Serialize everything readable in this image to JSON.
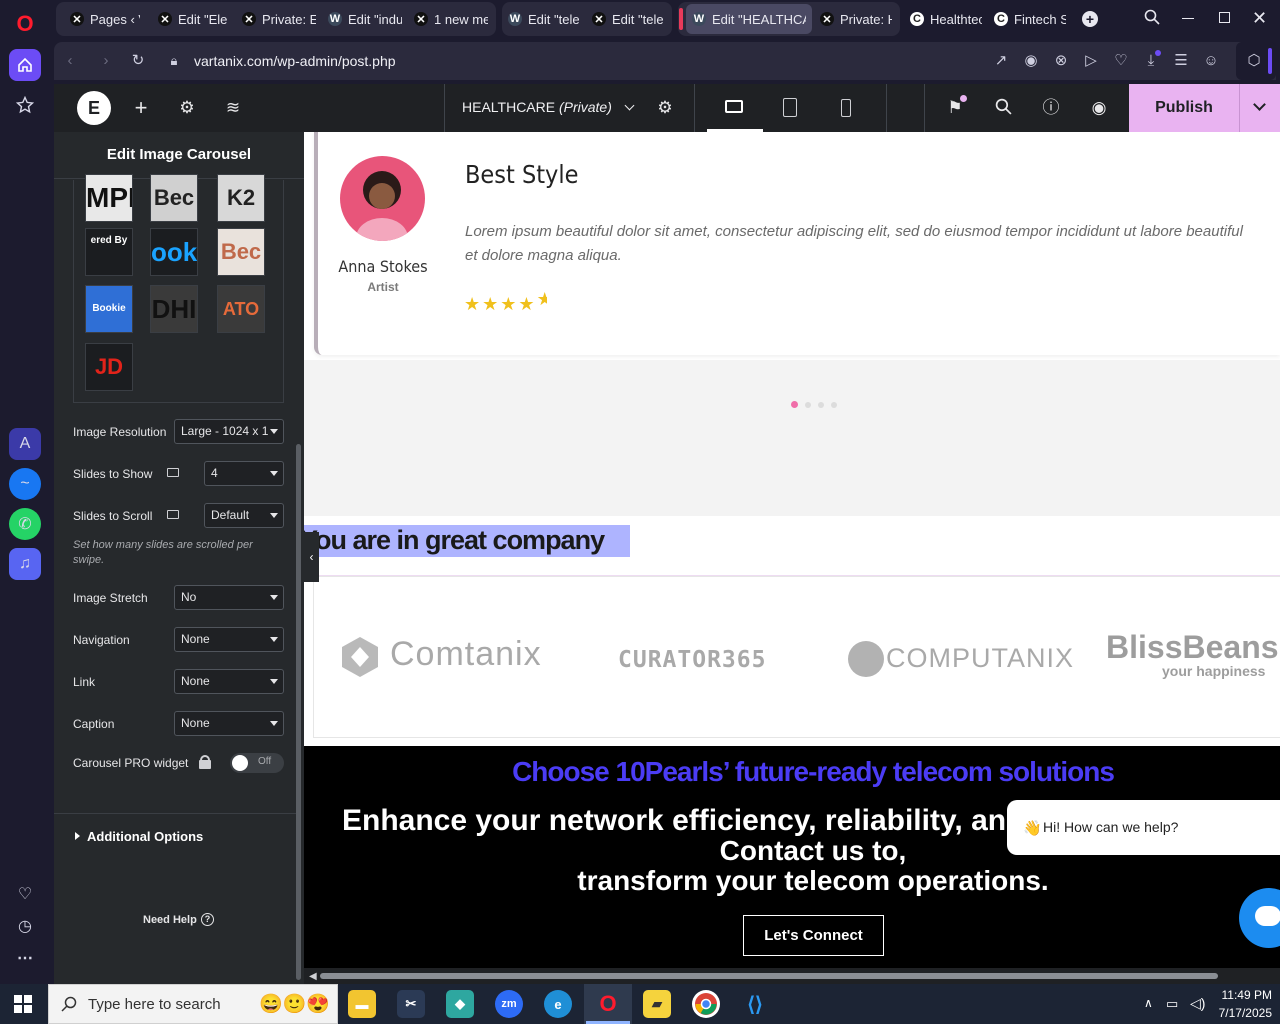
{
  "browser": {
    "tabs": [
      {
        "label": "Pages ‹ Va",
        "icon": "x-icon"
      },
      {
        "label": "Edit \"Elem",
        "icon": "x-icon"
      },
      {
        "label": "Private: Ele",
        "icon": "x-icon"
      },
      {
        "label": "Edit \"indus",
        "icon": "wordpress-icon"
      },
      {
        "label": "1 new mes",
        "icon": "x-icon"
      },
      {
        "label": "Edit \"teleco",
        "icon": "wordpress-icon"
      },
      {
        "label": "Edit \"teleco",
        "icon": "x-icon"
      },
      {
        "label": "Edit \"HEALTHCARE",
        "icon": "wordpress-icon"
      },
      {
        "label": "Private: HE",
        "icon": "x-icon"
      },
      {
        "label": "Healthtech",
        "icon": "clinic-icon"
      },
      {
        "label": "Fintech So",
        "icon": "clinic-icon"
      }
    ],
    "url": "vartanix.com/wp-admin/post.php"
  },
  "editor": {
    "document_title": "HEALTHCARE",
    "document_status": "(Private)",
    "publish_label": "Publish"
  },
  "panel": {
    "title": "Edit Image Carousel",
    "thumbs": [
      "MPL",
      "Bec",
      "K2",
      "ered By",
      "ook",
      "Bec",
      "Bookie",
      "DHI",
      "ATO",
      "JD"
    ],
    "controls": {
      "image_resolution": {
        "label": "Image Resolution",
        "value": "Large - 1024 x 1"
      },
      "slides_to_show": {
        "label": "Slides to Show",
        "value": "4"
      },
      "slides_to_scroll": {
        "label": "Slides to Scroll",
        "value": "Default"
      },
      "scroll_help": "Set how many slides are scrolled per swipe.",
      "image_stretch": {
        "label": "Image Stretch",
        "value": "No"
      },
      "navigation": {
        "label": "Navigation",
        "value": "None"
      },
      "link": {
        "label": "Link",
        "value": "None"
      },
      "caption": {
        "label": "Caption",
        "value": "None"
      },
      "carousel_pro": {
        "label": "Carousel PRO widget",
        "toggle": "Off"
      }
    },
    "additional_options": "Additional Options",
    "need_help": "Need Help"
  },
  "canvas": {
    "testimonial": {
      "name": "Anna Stokes",
      "role": "Artist",
      "heading": "Best Style",
      "body": "Lorem ipsum beautiful dolor sit amet, consectetur adipiscing elit, sed do eiusmod tempor incididunt ut labore beautiful et dolore magna aliqua.",
      "rating": 4.5
    },
    "company_heading": "You are in great company",
    "logos": [
      {
        "name": "Comtanix"
      },
      {
        "name": "CURATOR365"
      },
      {
        "name": "COMPUTANIX"
      },
      {
        "name": "BlissBeans",
        "tagline": "your happiness"
      }
    ],
    "cta": {
      "kicker": "Choose 10Pearls’ future-ready telecom solutions",
      "line1": "Enhance your network efficiency, reliability, and cu",
      "line2": "Contact us to,",
      "line3": "transform your telecom operations.",
      "button": "Let's Connect"
    },
    "chat": {
      "message": "Hi! How can we help?"
    }
  },
  "taskbar": {
    "search_placeholder": "Type here to search",
    "time": "11:49 PM",
    "date": "7/17/2025"
  },
  "colors": {
    "publish_bg": "#e9b3f1",
    "cta_kicker": "#4b3cf5",
    "star": "#f0c01c",
    "selection": "#aeb4ff"
  }
}
